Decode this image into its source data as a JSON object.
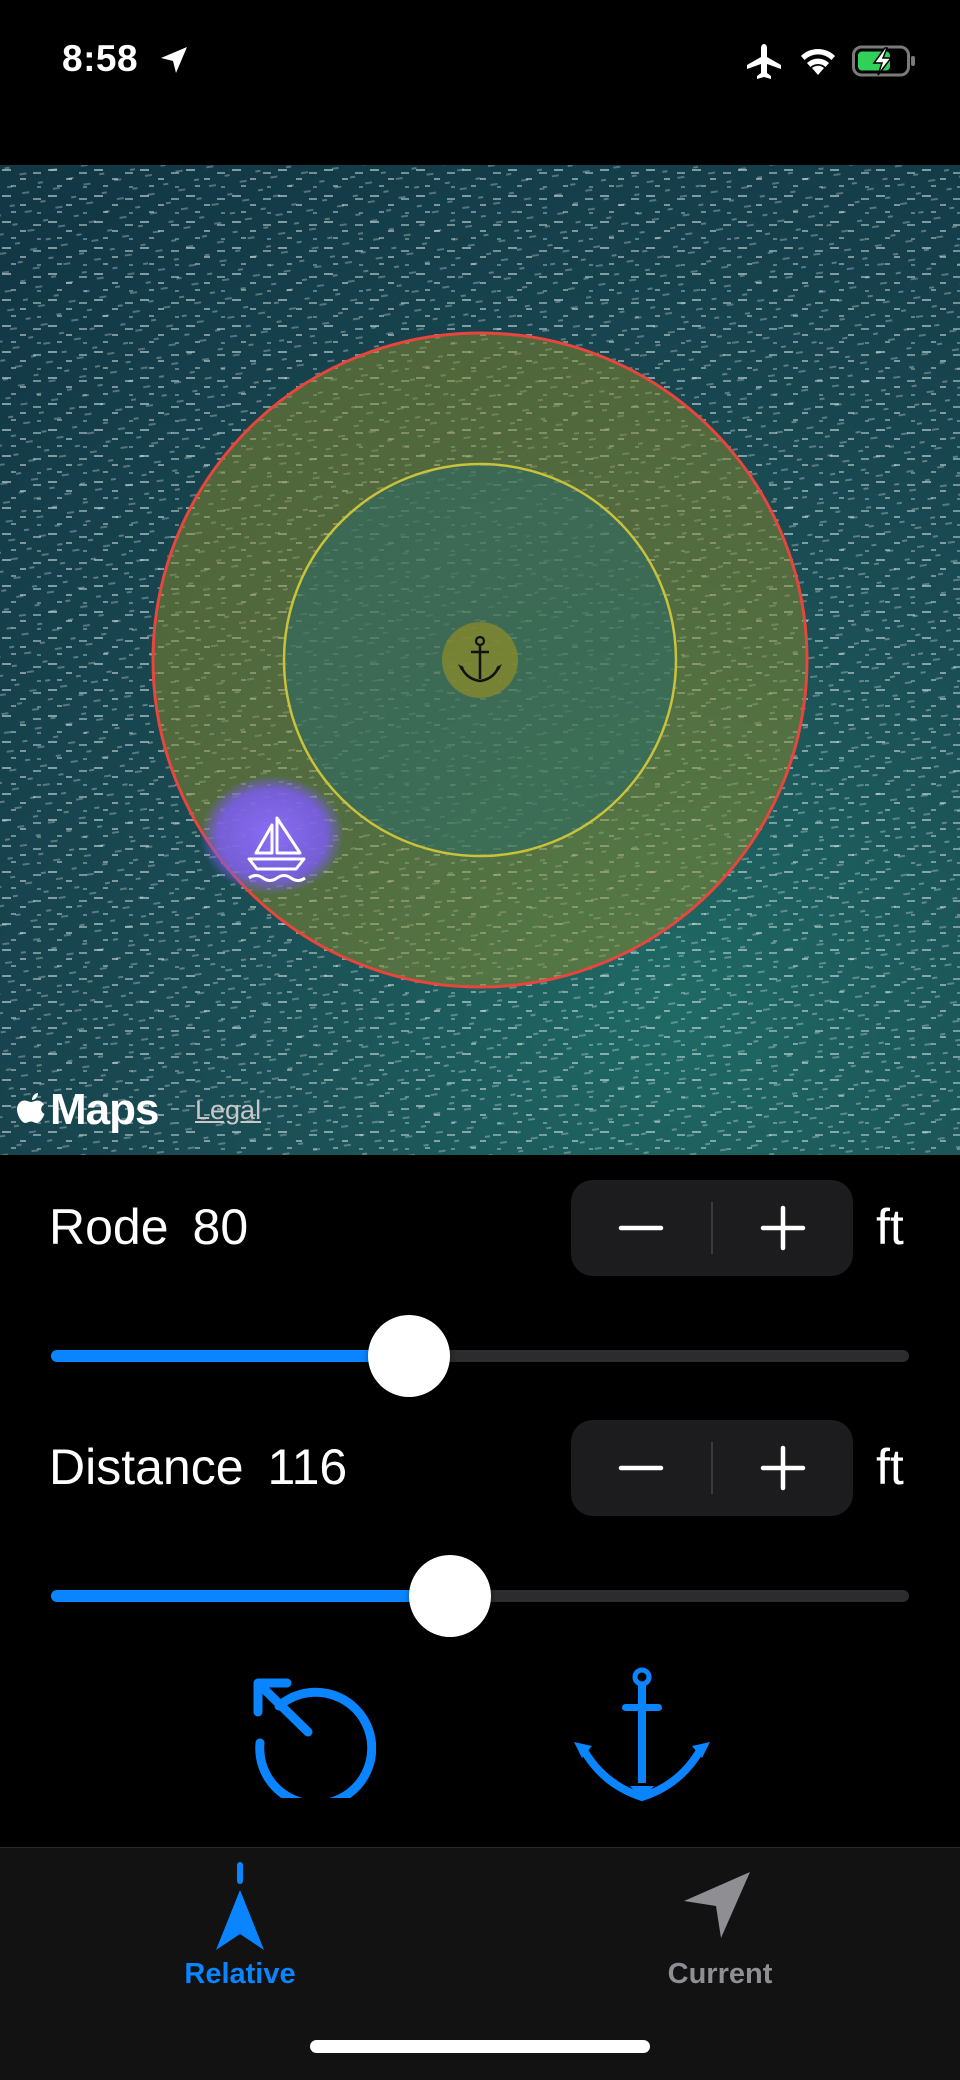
{
  "status_bar": {
    "time": "8:58",
    "icons": [
      "location-arrow-icon",
      "airplane-mode-icon",
      "wifi-icon",
      "battery-charging-icon"
    ]
  },
  "map": {
    "attribution": "Maps",
    "legal_link": "Legal",
    "markers": [
      "anchor-marker-icon",
      "boat-marker-icon"
    ],
    "colors": {
      "water": "#1b4a52",
      "outer_ring": "#e8453c",
      "swing_zone_fill": "#8a8a2a",
      "inner_ring": "#c9c23a",
      "boat_halo": "#8a6cff"
    }
  },
  "controls": {
    "rode": {
      "label": "Rode",
      "value": "80",
      "unit": "ft",
      "slider_fraction": 0.417
    },
    "distance": {
      "label": "Distance",
      "value": "116",
      "unit": "ft",
      "slider_fraction": 0.465
    },
    "actions": [
      "reset-icon",
      "drop-anchor-icon"
    ]
  },
  "tab_bar": {
    "tabs": [
      {
        "label": "Relative",
        "icon": "relative-arrow-icon",
        "selected": true
      },
      {
        "label": "Current",
        "icon": "current-location-icon",
        "selected": false
      }
    ],
    "accent_color": "#0a84ff",
    "inactive_color": "#8e8e93"
  }
}
